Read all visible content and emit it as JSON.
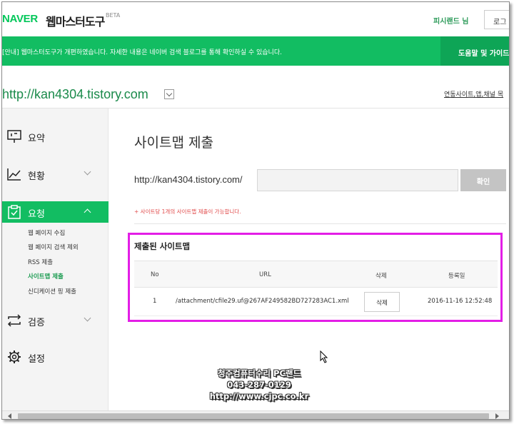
{
  "header": {
    "logo_brand": "NAVER",
    "logo_product": "웹마스터도구",
    "beta": "BETA",
    "user_name": "피시랜드 님",
    "logout_label": "로그"
  },
  "notice": {
    "text": "[안내] 웹마스터도구가 개편하였습니다. 자세한 내용은 네이버 검색 블로그를 통해 확인하실 수 있습니다.",
    "help_label": "도움말 및 가이드"
  },
  "sitebar": {
    "url": "http://kan4304.tistory.com",
    "linked_link": "연동사이트,앱,채널 목"
  },
  "sidebar": {
    "items": [
      {
        "label": "요약"
      },
      {
        "label": "현황"
      },
      {
        "label": "요청"
      },
      {
        "label": "검증"
      },
      {
        "label": "설정"
      }
    ],
    "sub_items": [
      {
        "label": "웹 페이지 수집"
      },
      {
        "label": "웹 페이지 검색 제외"
      },
      {
        "label": "RSS 제출"
      },
      {
        "label": "사이트맵 제출"
      },
      {
        "label": "신디케이션 핑 제출"
      }
    ]
  },
  "main": {
    "title": "사이트맵 제출",
    "url_prefix": "http://kan4304.tistory.com/",
    "input_value": "",
    "confirm_label": "확인",
    "hint": "+ 사이트당 1개의 사이트맵 제출이 가능합니다.",
    "submitted_title": "제출된 사이트맵",
    "table": {
      "headers": [
        "No",
        "URL",
        "삭제",
        "등록일"
      ],
      "rows": [
        {
          "no": "1",
          "url": "/attachment/cfile29.uf@267AF249582BD727283AC1.xml",
          "delete_label": "삭제",
          "date": "2016-11-16 12:52:48"
        }
      ]
    }
  },
  "watermark": {
    "line1": "청주컴퓨터수리 PC랜드",
    "line2": "043-287-0129",
    "line3": "http://www.cjpc.co.kr"
  },
  "colors": {
    "brand_green": "#12bd62",
    "highlight_magenta": "#e31ee6",
    "hint_red": "#e04848"
  }
}
